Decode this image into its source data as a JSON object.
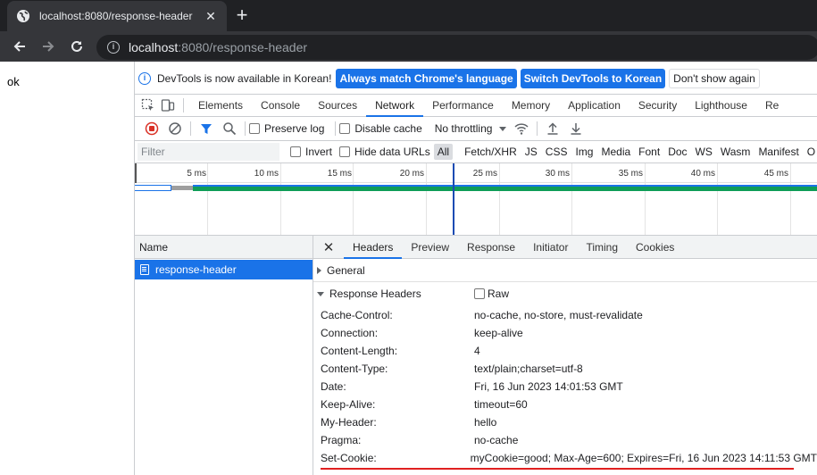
{
  "browser": {
    "tab_title": "localhost:8080/response-header",
    "url_host": "localhost",
    "url_rest": ":8080/response-header"
  },
  "page": {
    "body_text": "ok"
  },
  "devtools": {
    "infobar": {
      "message": "DevTools is now available in Korean!",
      "btn_match": "Always match Chrome's language",
      "btn_switch": "Switch DevTools to Korean",
      "btn_dismiss": "Don't show again"
    },
    "panels": [
      "Elements",
      "Console",
      "Sources",
      "Network",
      "Performance",
      "Memory",
      "Application",
      "Security",
      "Lighthouse",
      "Re"
    ],
    "network_toolbar": {
      "preserve_log": "Preserve log",
      "disable_cache": "Disable cache",
      "throttling": "No throttling"
    },
    "filter": {
      "placeholder": "Filter",
      "invert": "Invert",
      "hide_data_urls": "Hide data URLs",
      "types": [
        "All",
        "Fetch/XHR",
        "JS",
        "CSS",
        "Img",
        "Media",
        "Font",
        "Doc",
        "WS",
        "Wasm",
        "Manifest",
        "O"
      ]
    },
    "timeline_labels": [
      "5 ms",
      "10 ms",
      "15 ms",
      "20 ms",
      "25 ms",
      "30 ms",
      "35 ms",
      "40 ms",
      "45 ms"
    ],
    "requests": {
      "column_name": "Name",
      "items": [
        {
          "name": "response-header"
        }
      ]
    },
    "detail_tabs": [
      "Headers",
      "Preview",
      "Response",
      "Initiator",
      "Timing",
      "Cookies"
    ],
    "sections": {
      "general": "General",
      "response_headers": "Response Headers",
      "raw": "Raw"
    },
    "response_headers": [
      {
        "name": "Cache-Control:",
        "value": "no-cache, no-store, must-revalidate"
      },
      {
        "name": "Connection:",
        "value": "keep-alive"
      },
      {
        "name": "Content-Length:",
        "value": "4"
      },
      {
        "name": "Content-Type:",
        "value": "text/plain;charset=utf-8"
      },
      {
        "name": "Date:",
        "value": "Fri, 16 Jun 2023 14:01:53 GMT"
      },
      {
        "name": "Keep-Alive:",
        "value": "timeout=60"
      },
      {
        "name": "My-Header:",
        "value": "hello"
      },
      {
        "name": "Pragma:",
        "value": "no-cache"
      },
      {
        "name": "Set-Cookie:",
        "value": "myCookie=good; Max-Age=600; Expires=Fri, 16 Jun 2023 14:11:53 GMT"
      }
    ],
    "colors": {
      "accent": "#1a73e8",
      "recording": "#d93025",
      "waterfall": "#0f9d58",
      "highlight": "#e02020"
    }
  }
}
